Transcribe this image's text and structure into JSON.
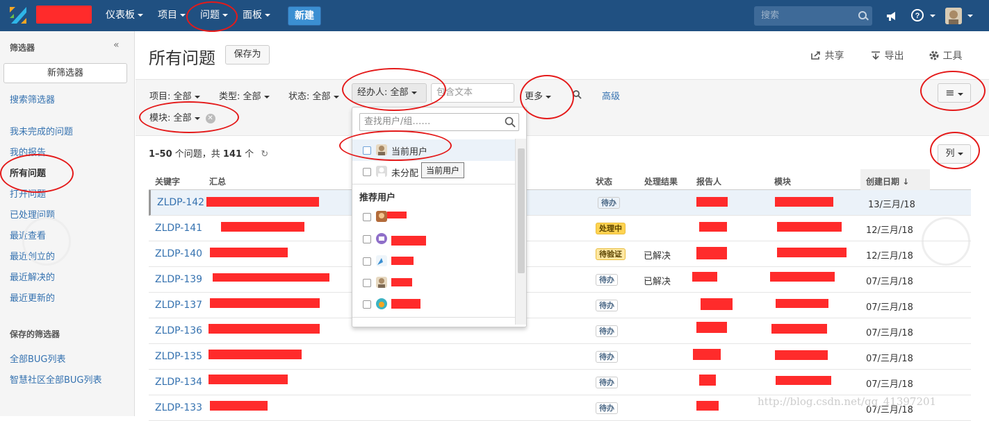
{
  "topbar": {
    "nav": [
      {
        "label": "仪表板"
      },
      {
        "label": "项目"
      },
      {
        "label": "问题"
      },
      {
        "label": "面板"
      }
    ],
    "create_label": "新建",
    "search_placeholder": "搜索"
  },
  "sidebar": {
    "filters_heading": "筛选器",
    "new_filter": "新筛选器",
    "search_filters": "搜索筛选器",
    "items": [
      {
        "label": "我未完成的问题"
      },
      {
        "label": "我的报告"
      },
      {
        "label": "所有问题"
      },
      {
        "label": "打开问题"
      },
      {
        "label": "已处理问题"
      },
      {
        "label": "最近查看"
      },
      {
        "label": "最近创立的"
      },
      {
        "label": "最近解决的"
      },
      {
        "label": "最近更新的"
      }
    ],
    "saved_heading": "保存的筛选器",
    "saved": [
      {
        "label": "全部BUG列表"
      },
      {
        "label": "智慧社区全部BUG列表"
      }
    ]
  },
  "header": {
    "title": "所有问题",
    "save_as": "保存为",
    "share": "共享",
    "export": "导出",
    "tools": "工具"
  },
  "filters": {
    "project": "项目: 全部",
    "type": "类型: 全部",
    "status": "状态: 全部",
    "assignee": "经办人: 全部",
    "text_placeholder": "包含文本",
    "more": "更多",
    "advanced": "高级",
    "module": "模块: 全部"
  },
  "assignee_dropdown": {
    "search_placeholder": "查找用户/组……",
    "current_user": "当前用户",
    "unassigned": "未分配",
    "recommended_heading": "推荐用户",
    "tooltip": "当前用户"
  },
  "results": {
    "count_range": "1–50",
    "count_mid": " 个问题，共 ",
    "count_total": "141",
    "count_tail": " 个",
    "columns_button": "列"
  },
  "columns": {
    "key": "关键字",
    "summary": "汇总",
    "status": "状态",
    "resolution": "处理结果",
    "reporter": "报告人",
    "module": "模块",
    "created": "创建日期"
  },
  "issues": [
    {
      "key": "ZLDP-142",
      "status": "待办",
      "resolution": "",
      "created": "13/三月/18"
    },
    {
      "key": "ZLDP-141",
      "status": "处理中",
      "resolution": "",
      "created": "12/三月/18"
    },
    {
      "key": "ZLDP-140",
      "status": "待验证",
      "resolution": "已解决",
      "created": "12/三月/18"
    },
    {
      "key": "ZLDP-139",
      "status": "待办",
      "resolution": "已解决",
      "created": "07/三月/18"
    },
    {
      "key": "ZLDP-137",
      "status": "待办",
      "resolution": "",
      "created": "07/三月/18"
    },
    {
      "key": "ZLDP-136",
      "status": "待办",
      "resolution": "",
      "created": "07/三月/18"
    },
    {
      "key": "ZLDP-135",
      "status": "待办",
      "resolution": "",
      "created": "07/三月/18"
    },
    {
      "key": "ZLDP-134",
      "status": "待办",
      "resolution": "",
      "created": "07/三月/18"
    },
    {
      "key": "ZLDP-133",
      "status": "待办",
      "resolution": "",
      "created": "07/三月/18"
    }
  ],
  "watermark": "http://blog.csdn.net/qq_41397201",
  "colors": {
    "topbar": "#205081",
    "link": "#3572b0",
    "redaction": "#ff2b2b",
    "annotation": "#e41a1a",
    "status_todo": "#4a6785",
    "status_progress": "#594300",
    "status_verify": "#594300"
  }
}
